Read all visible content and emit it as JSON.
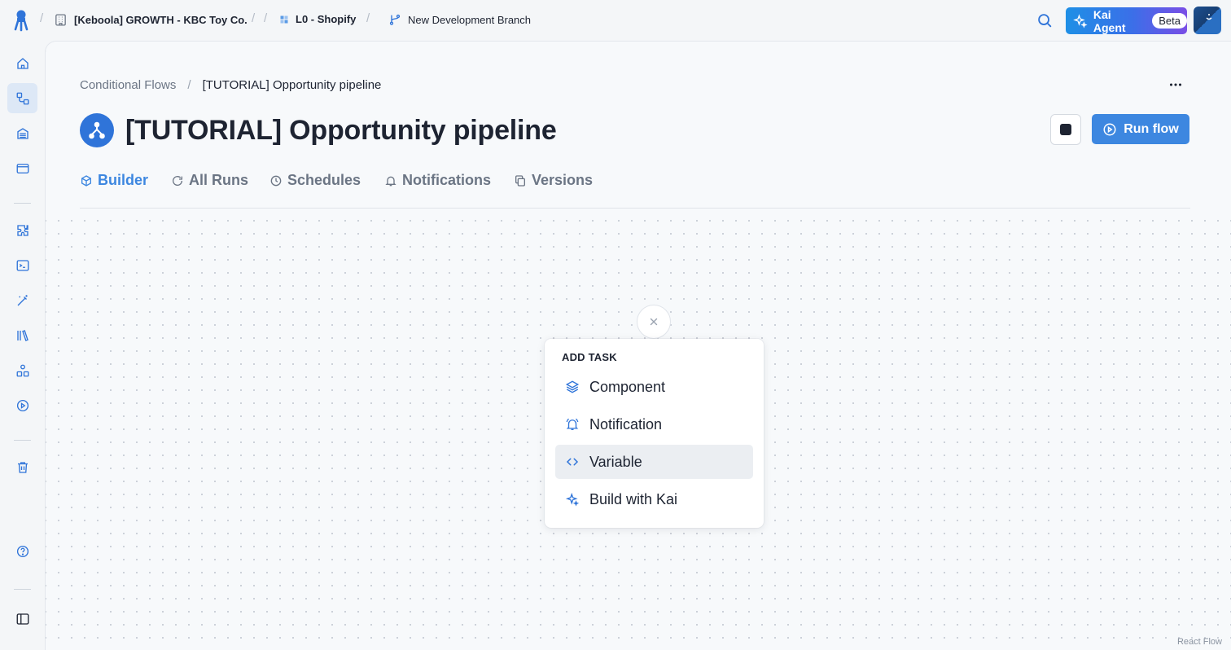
{
  "topbar": {
    "project": "[Keboola] GROWTH - KBC Toy Co.",
    "config": "L0 - Shopify",
    "branch": "New Development Branch",
    "kai_label": "Kai Agent",
    "kai_badge": "Beta",
    "separator": "/"
  },
  "sidebar": {
    "items": [
      {
        "icon": "home-icon"
      },
      {
        "icon": "flows-icon",
        "active": true
      },
      {
        "icon": "storage-icon"
      },
      {
        "icon": "data-apps-icon"
      },
      {
        "icon": "components-icon"
      },
      {
        "icon": "terminal-icon"
      },
      {
        "icon": "magic-wand-icon"
      },
      {
        "icon": "library-icon"
      },
      {
        "icon": "templates-icon"
      },
      {
        "icon": "jobs-icon"
      },
      {
        "icon": "trash-icon"
      },
      {
        "icon": "help-icon"
      },
      {
        "icon": "collapse-sidebar-icon"
      }
    ]
  },
  "main": {
    "breadcrumb": {
      "parent": "Conditional Flows",
      "separator": "/",
      "current": "[TUTORIAL] Opportunity pipeline"
    },
    "title": "[TUTORIAL] Opportunity pipeline",
    "run_button": "Run flow",
    "tabs": [
      {
        "label": "Builder",
        "icon": "cube-icon",
        "active": true
      },
      {
        "label": "All Runs",
        "icon": "refresh-icon"
      },
      {
        "label": "Schedules",
        "icon": "clock-icon"
      },
      {
        "label": "Notifications",
        "icon": "bell-icon"
      },
      {
        "label": "Versions",
        "icon": "copy-icon"
      }
    ]
  },
  "add_task_menu": {
    "title": "ADD TASK",
    "items": [
      {
        "label": "Component",
        "icon": "layers-icon"
      },
      {
        "label": "Notification",
        "icon": "bell-ring-icon"
      },
      {
        "label": "Variable",
        "icon": "code-icon",
        "hovered": true
      },
      {
        "label": "Build with Kai",
        "icon": "sparkle-icon"
      }
    ]
  },
  "attribution": "React Flow",
  "colors": {
    "accent": "#3d87e0",
    "icon_blue": "#2f74d9",
    "text": "#1e2432",
    "muted": "#6b7584"
  }
}
